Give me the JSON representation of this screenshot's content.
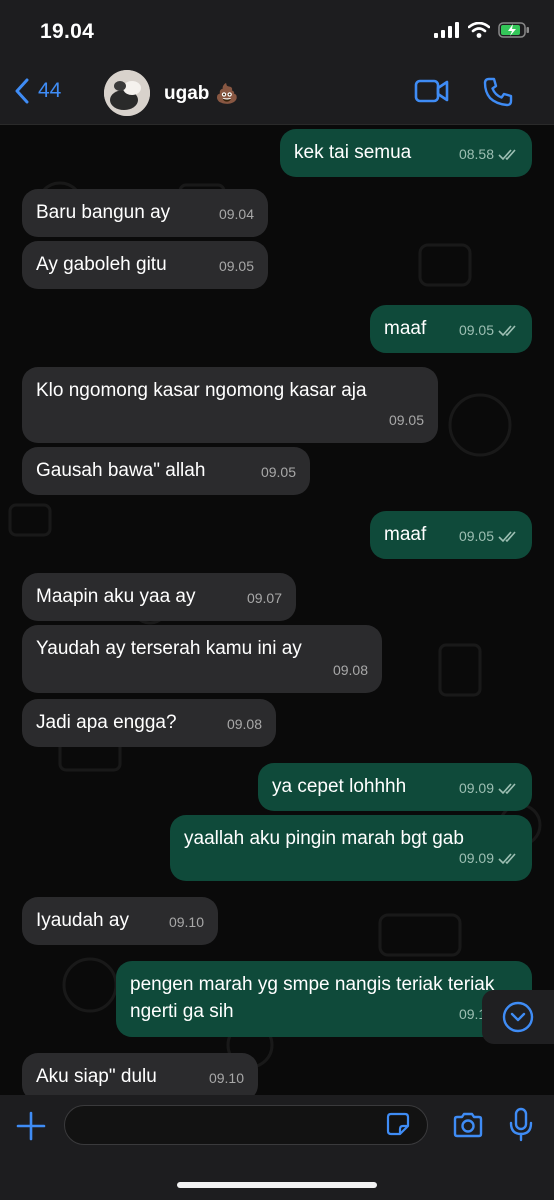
{
  "status_bar": {
    "time": "19.04"
  },
  "header": {
    "back_count": "44",
    "contact_name": "ugab",
    "contact_emoji": "💩"
  },
  "messages": [
    {
      "direction": "out",
      "text": "kek tai semua",
      "time": "08.58",
      "ticks": true
    },
    {
      "direction": "in",
      "text": "Baru bangun ay",
      "time": "09.04"
    },
    {
      "direction": "in",
      "text": "Ay gaboleh gitu",
      "time": "09.05"
    },
    {
      "direction": "out",
      "text": "maaf",
      "time": "09.05",
      "ticks": true
    },
    {
      "direction": "in",
      "text": "Klo ngomong kasar ngomong kasar aja",
      "time": "09.05"
    },
    {
      "direction": "in",
      "text": "Gausah bawa\" allah",
      "time": "09.05"
    },
    {
      "direction": "out",
      "text": "maaf",
      "time": "09.05",
      "ticks": true
    },
    {
      "direction": "in",
      "text": "Maapin aku yaa ay",
      "time": "09.07"
    },
    {
      "direction": "in",
      "text": "Yaudah ay terserah kamu ini ay",
      "time": "09.08"
    },
    {
      "direction": "in",
      "text": "Jadi apa engga?",
      "time": "09.08"
    },
    {
      "direction": "out",
      "text": "ya cepet lohhhh",
      "time": "09.09",
      "ticks": true
    },
    {
      "direction": "out",
      "text": "yaallah aku pingin marah bgt gab",
      "time": "09.09",
      "ticks": true
    },
    {
      "direction": "in",
      "text": "Iyaudah ay",
      "time": "09.10"
    },
    {
      "direction": "out",
      "text": "pengen marah yg smpe nangis teriak teriak ngerti ga sih",
      "time": "09.10",
      "ticks": true
    },
    {
      "direction": "in",
      "text": "Aku siap\" dulu",
      "time": "09.10"
    }
  ],
  "input": {
    "placeholder": ""
  },
  "icons": {
    "back": "chevron-left-icon",
    "video": "video-camera-icon",
    "call": "phone-icon",
    "scroll": "chevron-down-icon",
    "plus": "plus-icon",
    "sticker": "sticker-icon",
    "camera": "camera-icon",
    "mic": "microphone-icon"
  },
  "colors": {
    "accent": "#3f8cf5",
    "outgoing_bubble": "#0f4a3a",
    "incoming_bubble": "#2b2b2d",
    "background": "#0a0a0a"
  }
}
